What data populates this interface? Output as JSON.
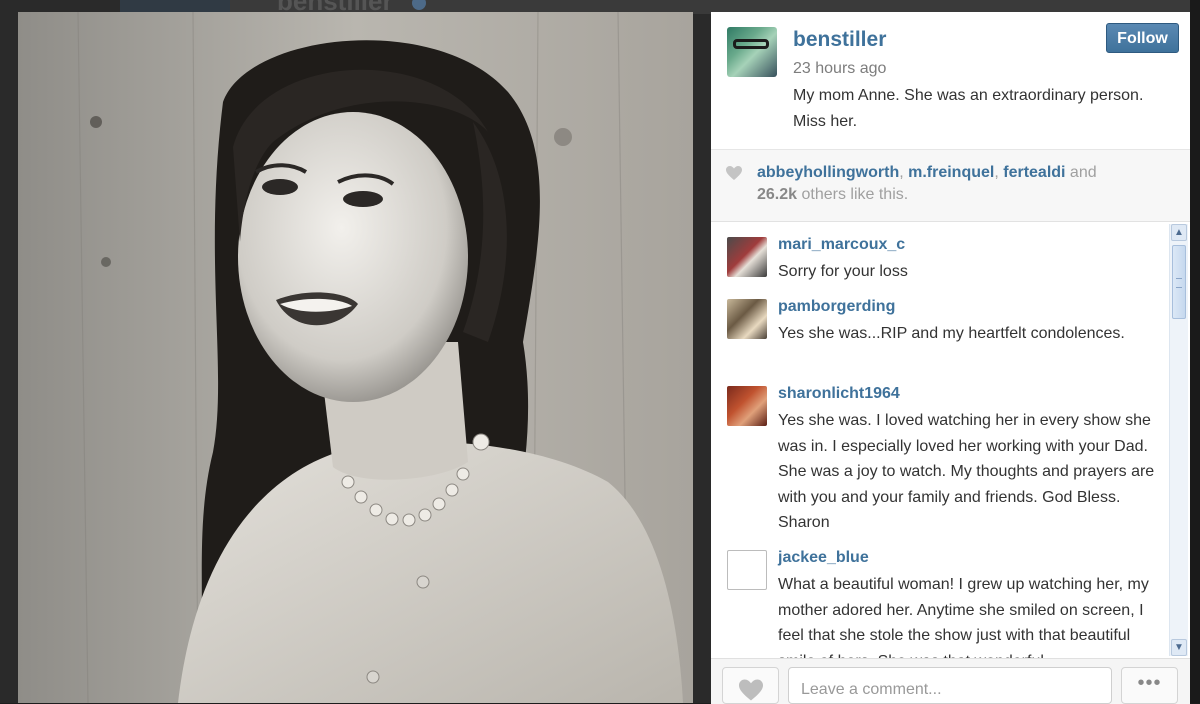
{
  "background_page": {
    "username": "benstiller"
  },
  "post": {
    "author": "benstiller",
    "time": "23 hours ago",
    "caption": "My mom Anne. She was an extraordinary person. Miss her.",
    "follow_label": "Follow",
    "photo_alt": "Black and white portrait photo"
  },
  "likes": {
    "users": [
      "abbeyhollingworth",
      "m.freinquel",
      "fertealdi"
    ],
    "sep": ", ",
    "and_text": " and",
    "count": "26.2k",
    "others_text": " others like this."
  },
  "comments": [
    {
      "user": "mari_marcoux_c",
      "text": "Sorry for your loss"
    },
    {
      "user": "pamborgerding",
      "text": "Yes she was...RIP and my heartfelt condolences."
    },
    {
      "user": "sharonlicht1964",
      "text": "Yes she was. I loved watching her in every show she was in. I especially loved her working with your Dad. She was a joy to watch. My thoughts and prayers are with you and your family and friends. God Bless. Sharon"
    },
    {
      "user": "jackee_blue",
      "text": "What a beautiful woman! I grew up watching her, my mother adored her. Anytime she smiled on screen, I feel that she stole the show just with that beautiful smile of hers. She was that wonderful."
    }
  ],
  "footer": {
    "comment_placeholder": "Leave a comment...",
    "more_label": "•••"
  },
  "colors": {
    "link_blue": "#3f729b",
    "follow_button": "#3f729b"
  },
  "icons": {
    "like": "heart-icon",
    "more": "ellipsis-icon",
    "scroll_up": "scroll-up-arrow-icon",
    "scroll_down": "scroll-down-arrow-icon"
  }
}
